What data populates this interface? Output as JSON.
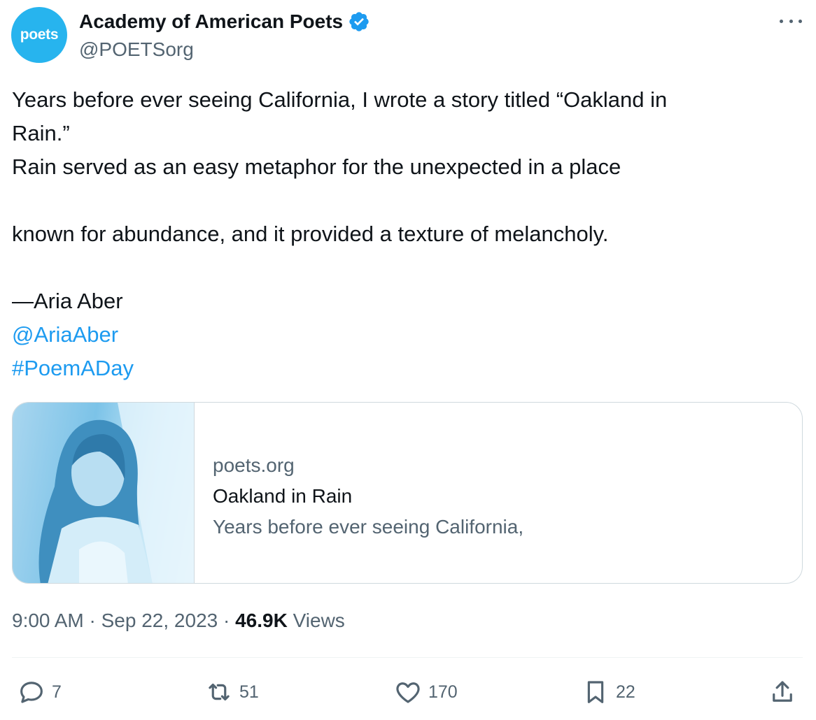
{
  "author": {
    "avatar_text": "poets",
    "name": "Academy of American Poets",
    "handle": "@POETSorg"
  },
  "tweet": {
    "lines": [
      "Years before ever seeing California, I wrote a story titled “Oakland in",
      "Rain.”",
      "Rain served as an easy metaphor for the unexpected in a place",
      "",
      "known for abundance, and it provided a texture of melancholy.",
      "",
      "—Aria Aber"
    ],
    "mention": "@AriaAber",
    "hashtag": "#PoemADay"
  },
  "card": {
    "domain": "poets.org",
    "title": "Oakland in Rain",
    "description": "Years before ever seeing California,"
  },
  "meta": {
    "time": "9:00 AM",
    "separator": " · ",
    "date": "Sep 22, 2023",
    "views_count": "46.9K",
    "views_label": " Views"
  },
  "actions": {
    "replies": "7",
    "reposts": "51",
    "likes": "170",
    "bookmarks": "22"
  },
  "colors": {
    "accent": "#1d9bf0",
    "avatar_bg": "#27b4ee",
    "secondary_text": "#536471"
  }
}
